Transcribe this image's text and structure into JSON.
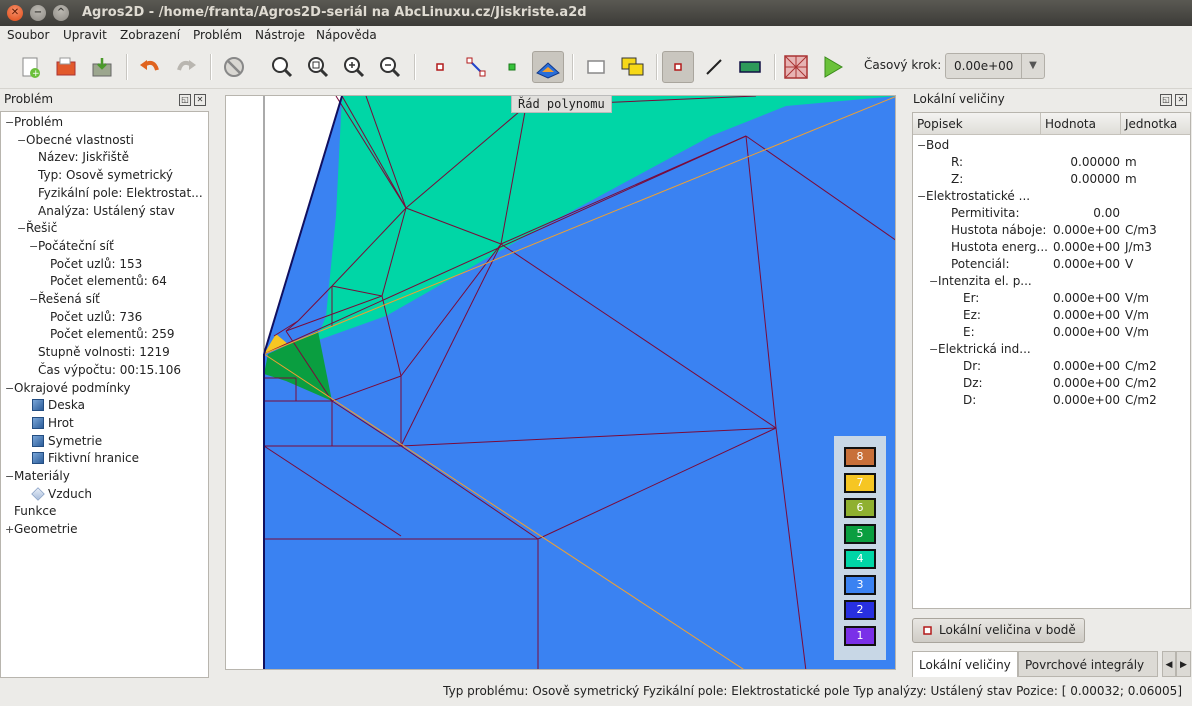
{
  "window": {
    "title": "Agros2D - /home/franta/Agros2D-seriál na AbcLinuxu.cz/Jiskriste.a2d"
  },
  "menu": [
    {
      "label": "Soubor"
    },
    {
      "label": "Upravit"
    },
    {
      "label": "Zobrazení"
    },
    {
      "label": "Problém"
    },
    {
      "label": "Nástroje"
    },
    {
      "label": "Nápověda"
    }
  ],
  "toolbar": {
    "timestep_label": "Časový krok:",
    "timestep_value": "0.00e+00",
    "icons": [
      "new-document-icon",
      "open-folder-icon",
      "save-icon",
      "undo-icon",
      "redo-icon",
      "stop-icon",
      "zoom-best-fit-icon",
      "zoom-region-icon",
      "zoom-in-icon",
      "zoom-out-icon",
      "node-mode-icon",
      "edge-mode-icon",
      "label-mode-icon",
      "postprocessor-mode-icon",
      "select-icon",
      "group-icon",
      "node-select-icon",
      "line-icon",
      "rectangle-icon",
      "mesh-icon",
      "solve-icon"
    ]
  },
  "left_panel": {
    "title": "Problém",
    "tree": [
      {
        "label": "Problém",
        "level": 0,
        "exp": "−"
      },
      {
        "label": "Obecné vlastnosti",
        "level": 1,
        "exp": "−"
      },
      {
        "label": "Název: Jiskřiště",
        "level": 2
      },
      {
        "label": "Typ: Osově symetrický",
        "level": 2
      },
      {
        "label": "Fyzikální pole: Elektrostat...",
        "level": 2
      },
      {
        "label": "Analýza: Ustálený stav",
        "level": 2
      },
      {
        "label": "Řešič",
        "level": 1,
        "exp": "−"
      },
      {
        "label": "Počáteční síť",
        "level": 2,
        "exp": "−"
      },
      {
        "label": "Počet uzlů: 153",
        "level": 3
      },
      {
        "label": "Počet elementů: 64",
        "level": 3
      },
      {
        "label": "Řešená síť",
        "level": 2,
        "exp": "−"
      },
      {
        "label": "Počet uzlů: 736",
        "level": 3
      },
      {
        "label": "Počet elementů: 259",
        "level": 3
      },
      {
        "label": "Stupně volnosti: 1219",
        "level": 2
      },
      {
        "label": "Čas výpočtu: 00:15.106",
        "level": 2
      },
      {
        "label": "Okrajové podmínky",
        "level": 0,
        "exp": "−"
      },
      {
        "label": "Deska",
        "level": 1,
        "icon": "boundary"
      },
      {
        "label": "Hrot",
        "level": 1,
        "icon": "boundary"
      },
      {
        "label": "Symetrie",
        "level": 1,
        "icon": "boundary"
      },
      {
        "label": "Fiktivní hranice",
        "level": 1,
        "icon": "boundary"
      },
      {
        "label": "Materiály",
        "level": 0,
        "exp": "−"
      },
      {
        "label": "Vzduch",
        "level": 1,
        "icon": "material"
      },
      {
        "label": "Funkce",
        "level": 0
      },
      {
        "label": "Geometrie",
        "level": 0,
        "exp": "+"
      }
    ]
  },
  "canvas": {
    "title": "Řád polynomu",
    "legend": [
      {
        "label": "8",
        "color": "#c8703a"
      },
      {
        "label": "7",
        "color": "#f6c623"
      },
      {
        "label": "6",
        "color": "#8fb030"
      },
      {
        "label": "5",
        "color": "#0a9e40"
      },
      {
        "label": "4",
        "color": "#00d6a6"
      },
      {
        "label": "3",
        "color": "#3a82f2"
      },
      {
        "label": "2",
        "color": "#2830e0"
      },
      {
        "label": "1",
        "color": "#7a30e8"
      }
    ]
  },
  "right_panel": {
    "title": "Lokální veličiny",
    "columns": [
      "Popisek",
      "Hodnota",
      "Jednotka"
    ],
    "rows": [
      {
        "label": "Bod",
        "level": 0,
        "exp": "−",
        "value": "",
        "unit": ""
      },
      {
        "label": "R:",
        "level": 1,
        "value": "0.00000",
        "unit": "m"
      },
      {
        "label": "Z:",
        "level": 1,
        "value": "0.00000",
        "unit": "m"
      },
      {
        "label": "Elektrostatické ...",
        "level": 0,
        "exp": "−",
        "value": "",
        "unit": ""
      },
      {
        "label": "Permitivita:",
        "level": 1,
        "value": "0.00",
        "unit": ""
      },
      {
        "label": "Hustota náboje:",
        "level": 1,
        "value": "0.000e+00",
        "unit": "C/m3"
      },
      {
        "label": "Hustota energ...",
        "level": 1,
        "value": "0.000e+00",
        "unit": "J/m3"
      },
      {
        "label": "Potenciál:",
        "level": 1,
        "value": "0.000e+00",
        "unit": "V"
      },
      {
        "label": "Intenzita el. p...",
        "level": 1,
        "exp": "−",
        "value": "",
        "unit": ""
      },
      {
        "label": "Er:",
        "level": 2,
        "value": "0.000e+00",
        "unit": "V/m"
      },
      {
        "label": "Ez:",
        "level": 2,
        "value": "0.000e+00",
        "unit": "V/m"
      },
      {
        "label": "E:",
        "level": 2,
        "value": "0.000e+00",
        "unit": "V/m"
      },
      {
        "label": "Elektrická ind...",
        "level": 1,
        "exp": "−",
        "value": "",
        "unit": ""
      },
      {
        "label": "Dr:",
        "level": 2,
        "value": "0.000e+00",
        "unit": "C/m2"
      },
      {
        "label": "Dz:",
        "level": 2,
        "value": "0.000e+00",
        "unit": "C/m2"
      },
      {
        "label": "D:",
        "level": 2,
        "value": "0.000e+00",
        "unit": "C/m2"
      }
    ],
    "point_button": "Lokální veličina v bodě",
    "tabs": [
      {
        "label": "Lokální veličiny"
      },
      {
        "label": "Povrchové integrály"
      }
    ]
  },
  "status": {
    "text": "Typ problému: Osově symetrický  Fyzikální pole: Elektrostatické pole  Typ analýzy: Ustálený stav  Pozice: [ 0.00032;  0.06005]"
  }
}
